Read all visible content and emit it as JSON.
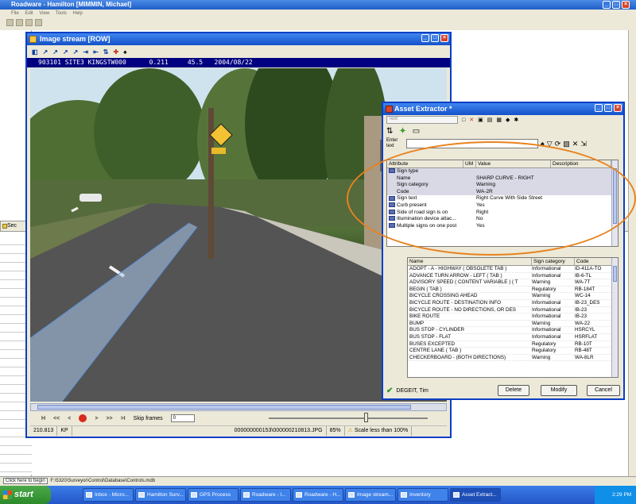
{
  "main_window": {
    "title": "Roadware - Hamilton [MIMMIN, Michael]",
    "menu": [
      "File",
      "Edit",
      "View",
      "Tools",
      "Help"
    ],
    "left_pane_label": "Sec",
    "path": "F:\\5320\\Surveyor\\Control\\Database\\Controls.mdb",
    "click_begin": "Click here to begin"
  },
  "image_window": {
    "title": "Image stream [ROW]",
    "info": "903101 SITE3 KINGSTW000      0.211     45.5   2004/08/22",
    "controls": [
      "H",
      "<<",
      "<",
      ">",
      ">>",
      ">I"
    ],
    "skip_label": "Skip frames",
    "skip_value": "0",
    "status_km": "210.813",
    "status_kp": "KP",
    "status_file": "000000000153\\000000210813.JPG",
    "status_zoom": "85%",
    "status_warning": "Scale less than 100%"
  },
  "asset_window": {
    "title": "Asset Extractor *",
    "filter_placeholder": "Text",
    "enter_label": "Enter text",
    "attr_headers": [
      "Attribute",
      "UM",
      "Value",
      "Description"
    ],
    "attributes": [
      {
        "attribute": "Sign type",
        "value": "",
        "group": true
      },
      {
        "attribute": "Name",
        "value": "SHARP CURVE - RIGHT",
        "group": false
      },
      {
        "attribute": "Sign category",
        "value": "Warning",
        "group": false
      },
      {
        "attribute": "Code",
        "value": "WA-2R",
        "group": false
      },
      {
        "attribute": "Sign text",
        "value": "Right Curve With Side Street",
        "group": true
      },
      {
        "attribute": "Curb present",
        "value": "Yes",
        "group": true
      },
      {
        "attribute": "Side of road sign is on",
        "value": "Right",
        "group": true
      },
      {
        "attribute": "Illumination device attac...",
        "value": "No",
        "group": true
      },
      {
        "attribute": "Multiple signs on one post",
        "value": "Yes",
        "group": true
      }
    ],
    "sign_headers": [
      "Name",
      "Sign category",
      "Code"
    ],
    "signs": [
      [
        "ADOPT - A - HIGHWAY ( OBSOLETE TAB )",
        "Informational",
        "ID-411A-TO"
      ],
      [
        "ADVANCE TURN ARROW - LEFT ( TAB )",
        "Informational",
        "IB-6-TL"
      ],
      [
        "ADVISORY SPEED ( CONTENT VARIABLE ) ( T",
        "Warning",
        "WA-7T"
      ],
      [
        "BEGIN ( TAB )",
        "Regulatory",
        "RB-184T"
      ],
      [
        "BICYCLE CROSSING AHEAD",
        "Warning",
        "WC-14"
      ],
      [
        "BICYCLE ROUTE - DESTINATION INFO",
        "Informational",
        "IB-23_DES"
      ],
      [
        "BICYCLE ROUTE - NO DIRECTIONS, OR DES",
        "Informational",
        "IB-23"
      ],
      [
        "BIKE ROUTE",
        "Informational",
        "IB-23"
      ],
      [
        "BUMP",
        "Warning",
        "WA-22"
      ],
      [
        "BUS STOP - CYLINDER",
        "Informational",
        "HSRCYL"
      ],
      [
        "BUS STOP - FLAT",
        "Informational",
        "HSRFLAT"
      ],
      [
        "BUSES EXCEPTED",
        "Regulatory",
        "RB-10T"
      ],
      [
        "CENTRE LANE ( TAB )",
        "Regulatory",
        "RB-48T"
      ],
      [
        "CHECKERBOARD - (BOTH DIRECTIONS)",
        "Warning",
        "WA-8LR"
      ]
    ],
    "user": "DEGEIT, Tim",
    "delete_label": "Delete",
    "modify_label": "Modify",
    "cancel_label": "Cancel"
  },
  "taskbar": {
    "start": "start",
    "tasks": [
      "Inbox - Micro...",
      "Hamilton Surv...",
      "GPS Process",
      "Roadware - I...",
      "Roadware - H...",
      "Image stream...",
      "Inventory",
      "Asset Extract..."
    ],
    "time": "2:29 PM"
  },
  "colors": {
    "highlight": "#e8821e",
    "title_blue": "#1451c9",
    "info_bar": "#000080"
  }
}
